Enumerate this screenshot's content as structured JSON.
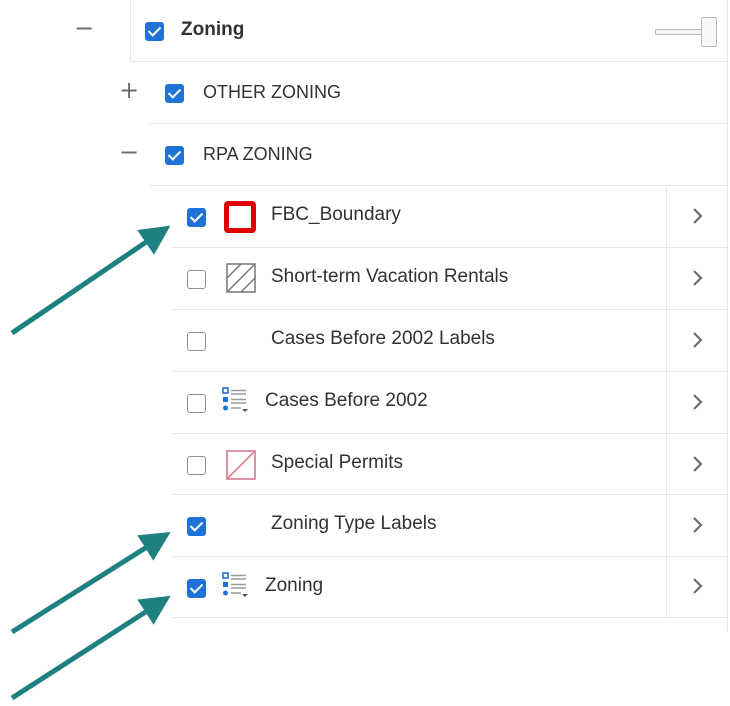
{
  "zoning_group": {
    "label": "Zoning",
    "checked": true,
    "collapse_symbol": "−"
  },
  "other_zoning": {
    "label": "OTHER ZONING",
    "checked": true,
    "expand_symbol": "+"
  },
  "rpa_zoning": {
    "label": "RPA ZONING",
    "checked": true,
    "collapse_symbol": "−"
  },
  "layers": [
    {
      "label": "FBC_Boundary",
      "checked": true,
      "icon": "red-square-outline-icon"
    },
    {
      "label": "Short-term Vacation Rentals",
      "checked": false,
      "icon": "hatched-square-icon"
    },
    {
      "label": "Cases Before 2002 Labels",
      "checked": false,
      "icon": ""
    },
    {
      "label": "Cases Before 2002",
      "checked": false,
      "icon": "legend-list-icon"
    },
    {
      "label": "Special Permits",
      "checked": false,
      "icon": "pink-diagonal-square-icon"
    },
    {
      "label": "Zoning Type Labels",
      "checked": true,
      "icon": ""
    },
    {
      "label": "Zoning",
      "checked": true,
      "icon": "legend-list-icon"
    }
  ],
  "colors": {
    "checkbox": "#1f73d6",
    "arrow": "#1e8080",
    "fbc_symbol": "#e00000",
    "special_permits": "#d9889a"
  }
}
